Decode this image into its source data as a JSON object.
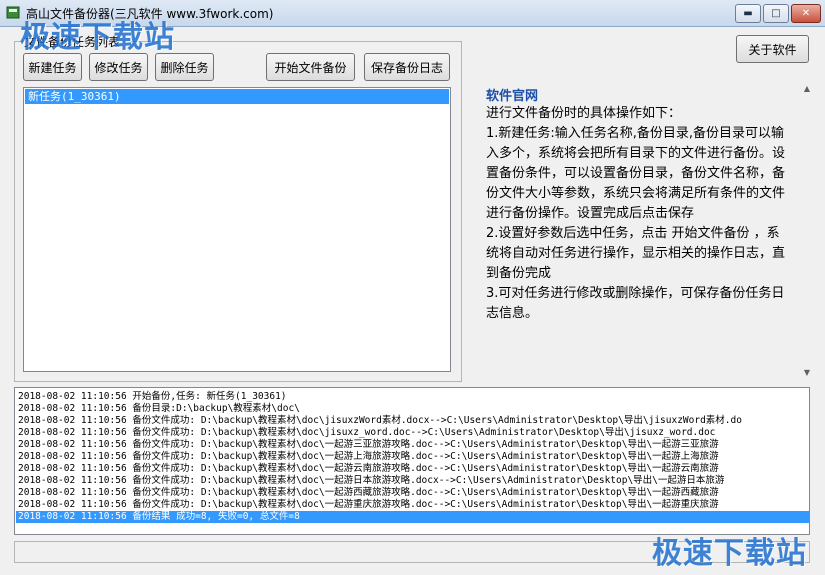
{
  "window": {
    "title": "高山文件备份器(三凡软件 www.3fwork.com)"
  },
  "watermark": {
    "top_left": "极速下载站",
    "bottom_right": "极速下载站"
  },
  "task_group": {
    "title": "文件备份任务列表"
  },
  "toolbar": {
    "new_task": "新建任务",
    "edit_task": "修改任务",
    "delete_task": "删除任务",
    "start_backup": "开始文件备份",
    "save_log": "保存备份日志",
    "about": "关于软件"
  },
  "tasks": [
    "新任务(1_30361)"
  ],
  "info": {
    "title": "软件官网",
    "lines": [
      "进行文件备份时的具体操作如下：",
      "1.新建任务:输入任务名称,备份目录,备份目录可以输入多个，系统将会把所有目录下的文件进行备份。设置备份条件，可以设置备份目录，备份文件名称，备份文件大小等参数，系统只会将满足所有条件的文件进行备份操作。设置完成后点击保存",
      "2.设置好参数后选中任务，点击  开始文件备份 ，系统将自动对任务进行操作，显示相关的操作日志，直到备份完成",
      "3.可对任务进行修改或删除操作，可保存备份任务日志信息。"
    ]
  },
  "log": [
    "2018-08-02 11:10:56 开始备份,任务: 新任务(1_30361)",
    "2018-08-02 11:10:56 备份目录:D:\\backup\\教程素材\\doc\\",
    "2018-08-02 11:10:56 备份文件成功: D:\\backup\\教程素材\\doc\\jisuxzWord素材.docx-->C:\\Users\\Administrator\\Desktop\\导出\\jisuxzWord素材.do",
    "2018-08-02 11:10:56 备份文件成功: D:\\backup\\教程素材\\doc\\jisuxz_word.doc-->C:\\Users\\Administrator\\Desktop\\导出\\jisuxz_word.doc",
    "2018-08-02 11:10:56 备份文件成功: D:\\backup\\教程素材\\doc\\一起游三亚旅游攻略.doc-->C:\\Users\\Administrator\\Desktop\\导出\\一起游三亚旅游",
    "2018-08-02 11:10:56 备份文件成功: D:\\backup\\教程素材\\doc\\一起游上海旅游攻略.doc-->C:\\Users\\Administrator\\Desktop\\导出\\一起游上海旅游",
    "2018-08-02 11:10:56 备份文件成功: D:\\backup\\教程素材\\doc\\一起游云南旅游攻略.doc-->C:\\Users\\Administrator\\Desktop\\导出\\一起游云南旅游",
    "2018-08-02 11:10:56 备份文件成功: D:\\backup\\教程素材\\doc\\一起游日本旅游攻略.docx-->C:\\Users\\Administrator\\Desktop\\导出\\一起游日本旅游",
    "2018-08-02 11:10:56 备份文件成功: D:\\backup\\教程素材\\doc\\一起游西藏旅游攻略.doc-->C:\\Users\\Administrator\\Desktop\\导出\\一起游西藏旅游",
    "2018-08-02 11:10:56 备份文件成功: D:\\backup\\教程素材\\doc\\一起游重庆旅游攻略.doc-->C:\\Users\\Administrator\\Desktop\\导出\\一起游重庆旅游",
    "2018-08-02 11:10:56 备份结果 成功=8, 失败=0, 总文件=8"
  ],
  "status": {
    "text": ""
  }
}
